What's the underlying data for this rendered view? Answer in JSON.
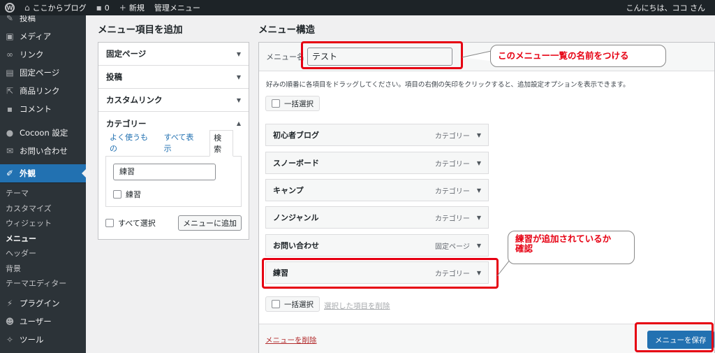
{
  "adminbar": {
    "wp_logo": "wp-logo-icon",
    "site_name": "ここからブログ",
    "comments_count": "0",
    "new_label": "新規",
    "manage_menu": "管理メニュー",
    "greeting": "こんにちは、ココ さん"
  },
  "sidebar": {
    "items_top": [
      {
        "icon": "pin-icon",
        "label": "投稿"
      },
      {
        "icon": "media-icon",
        "label": "メディア"
      },
      {
        "icon": "link-icon",
        "label": "リンク"
      },
      {
        "icon": "page-icon",
        "label": "固定ページ"
      },
      {
        "icon": "product-link-icon",
        "label": "商品リンク"
      },
      {
        "icon": "comment-icon",
        "label": "コメント"
      },
      {
        "icon": "cocoon-icon",
        "label": "Cocoon 設定"
      },
      {
        "icon": "mail-icon",
        "label": "お問い合わせ"
      }
    ],
    "active": {
      "icon": "brush-icon",
      "label": "外観"
    },
    "submenu": [
      "テーマ",
      "カスタマイズ",
      "ウィジェット",
      "メニュー",
      "ヘッダー",
      "背景",
      "テーマエディター"
    ],
    "items_bottom": [
      {
        "icon": "plugin-icon",
        "label": "プラグイン"
      },
      {
        "icon": "user-icon",
        "label": "ユーザー"
      },
      {
        "icon": "tool-icon",
        "label": "ツール"
      }
    ]
  },
  "left": {
    "heading": "メニュー項目を追加",
    "accordions": [
      "固定ページ",
      "投稿",
      "カスタムリンク",
      "カテゴリー"
    ],
    "tabs": [
      "よく使うもの",
      "すべて表示",
      "検索"
    ],
    "search_value": "練習",
    "result_label": "練習",
    "select_all": "すべて選択",
    "add_button": "メニューに追加"
  },
  "right": {
    "heading": "メニュー構造",
    "name_label": "メニュー名",
    "name_value": "テスト",
    "instructions": "好みの順番に各項目をドラッグしてください。項目の右側の矢印をクリックすると、追加設定オプションを表示できます。",
    "bulk_select": "一括選択",
    "items": [
      {
        "label": "初心者ブログ",
        "type": "カテゴリー"
      },
      {
        "label": "スノーボード",
        "type": "カテゴリー"
      },
      {
        "label": "キャンプ",
        "type": "カテゴリー"
      },
      {
        "label": "ノンジャンル",
        "type": "カテゴリー"
      },
      {
        "label": "お問い合わせ",
        "type": "固定ページ"
      },
      {
        "label": "練習",
        "type": "カテゴリー"
      }
    ],
    "delete_selected": "選択した項目を削除",
    "delete_menu": "メニューを削除",
    "save_button": "メニューを保存"
  },
  "annotations": {
    "callout_name": "このメニュー一覧の名前をつける",
    "callout_added_line1": "練習が追加されているか",
    "callout_added_line2": "確認",
    "accent": "#e60012"
  }
}
